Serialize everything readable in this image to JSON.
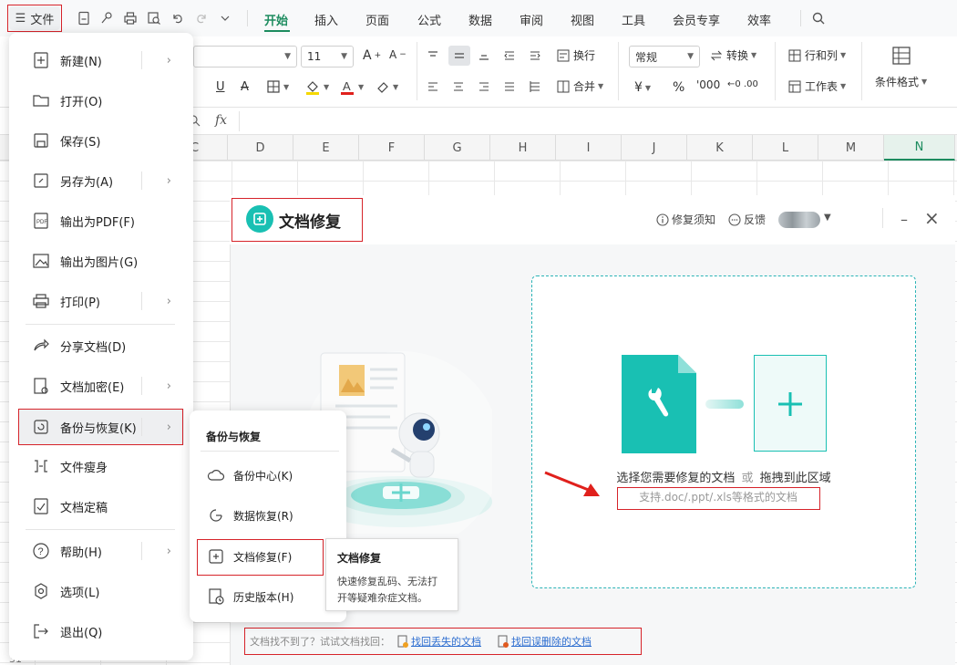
{
  "topbar": {
    "file_label": "文件",
    "tabs": [
      "开始",
      "插入",
      "页面",
      "公式",
      "数据",
      "审阅",
      "视图",
      "工具",
      "会员专享",
      "效率"
    ],
    "active_tab": "开始"
  },
  "ribbon": {
    "font_size": "11",
    "wrap_label": "换行",
    "merge_label": "合并",
    "number_format": "常规",
    "convert_label": "转换",
    "rowcol_label": "行和列",
    "sheet_label": "工作表",
    "cond_format_label": "条件格式",
    "currency_symbol": "¥",
    "percent_symbol": "%"
  },
  "formula_bar": {
    "fx_label": "fx"
  },
  "grid": {
    "columns": [
      "C",
      "D",
      "E",
      "F",
      "G",
      "H",
      "I",
      "J",
      "K",
      "L",
      "M",
      "N"
    ],
    "selected_column": "N",
    "row_label_bottom": "31"
  },
  "file_menu": {
    "items": [
      {
        "label": "新建(N)",
        "icon": "new-file-icon",
        "submenu": true
      },
      {
        "label": "打开(O)",
        "icon": "folder-open-icon",
        "submenu": false
      },
      {
        "label": "保存(S)",
        "icon": "save-icon",
        "submenu": false
      },
      {
        "label": "另存为(A)",
        "icon": "save-as-icon",
        "submenu": true
      },
      {
        "label": "输出为PDF(F)",
        "icon": "pdf-icon",
        "submenu": false
      },
      {
        "label": "输出为图片(G)",
        "icon": "image-icon",
        "submenu": false
      },
      {
        "label": "打印(P)",
        "icon": "printer-icon",
        "submenu": true
      },
      {
        "label": "分享文档(D)",
        "icon": "share-icon",
        "submenu": false
      },
      {
        "label": "文档加密(E)",
        "icon": "lock-file-icon",
        "submenu": true
      },
      {
        "label": "备份与恢复(K)",
        "icon": "backup-icon",
        "submenu": true
      },
      {
        "label": "文件瘦身",
        "icon": "slim-icon",
        "submenu": false
      },
      {
        "label": "文档定稿",
        "icon": "finalize-icon",
        "submenu": false
      },
      {
        "label": "帮助(H)",
        "icon": "help-icon",
        "submenu": true
      },
      {
        "label": "选项(L)",
        "icon": "options-icon",
        "submenu": false
      },
      {
        "label": "退出(Q)",
        "icon": "exit-icon",
        "submenu": false
      }
    ]
  },
  "submenu": {
    "title": "备份与恢复",
    "items": [
      {
        "label": "备份中心(K)",
        "icon": "cloud-backup-icon"
      },
      {
        "label": "数据恢复(R)",
        "icon": "data-recovery-icon"
      },
      {
        "label": "文档修复(F)",
        "icon": "doc-repair-icon"
      },
      {
        "label": "历史版本(H)",
        "icon": "history-icon"
      }
    ]
  },
  "tooltip": {
    "title": "文档修复",
    "desc_line1": "快速修复乱码、无法打",
    "desc_line2": "开等疑难杂症文档。"
  },
  "repair_panel": {
    "title": "文档修复",
    "notice_label": "修复须知",
    "feedback_label": "反馈",
    "drop_text_a": "选择您需要修复的文档",
    "drop_text_or": "或",
    "drop_text_b": "拖拽到此区域",
    "formats_hint": "支持.doc/.ppt/.xls等格式的文档",
    "footer_prompt": "文档找不到了？试试文档找回：",
    "footer_link1": "找回丢失的文档",
    "footer_link2": "找回误删除的文档"
  },
  "colors": {
    "brand_green": "#1d8c5f",
    "teal": "#19c0b3",
    "highlight_red": "#d6232a",
    "link_blue": "#2f6fd0"
  }
}
